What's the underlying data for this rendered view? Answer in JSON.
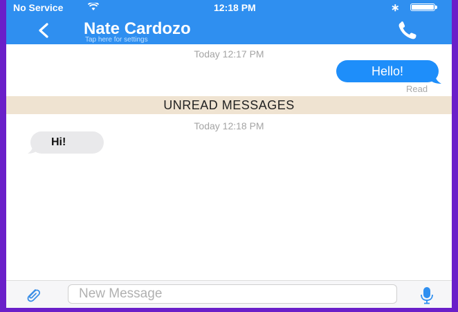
{
  "status_bar": {
    "carrier": "No Service",
    "time": "12:18 PM",
    "bluetooth_icon": "bluetooth-icon",
    "battery_icon": "battery-icon",
    "wifi_icon": "wifi-icon"
  },
  "nav": {
    "back_icon": "chevron-left-icon",
    "contact_name": "Nate Cardozo",
    "subtitle": "Tap here for settings",
    "call_icon": "phone-icon"
  },
  "messages": {
    "timestamp_1": "Today 12:17 PM",
    "outgoing_text": "Hello!",
    "read_receipt": "Read",
    "unread_banner": "UNREAD MESSAGES",
    "timestamp_2": "Today 12:18 PM",
    "incoming_text": "Hi!"
  },
  "composer": {
    "placeholder": "New Message",
    "value": "",
    "attach_icon": "paperclip-icon",
    "mic_icon": "microphone-icon"
  },
  "colors": {
    "header_blue": "#2f8ff0",
    "outgoing_bubble": "#1e8efa",
    "incoming_bubble": "#e9e9eb",
    "unread_banner": "#efe3d1",
    "border_purple": "#6a1fc9"
  }
}
